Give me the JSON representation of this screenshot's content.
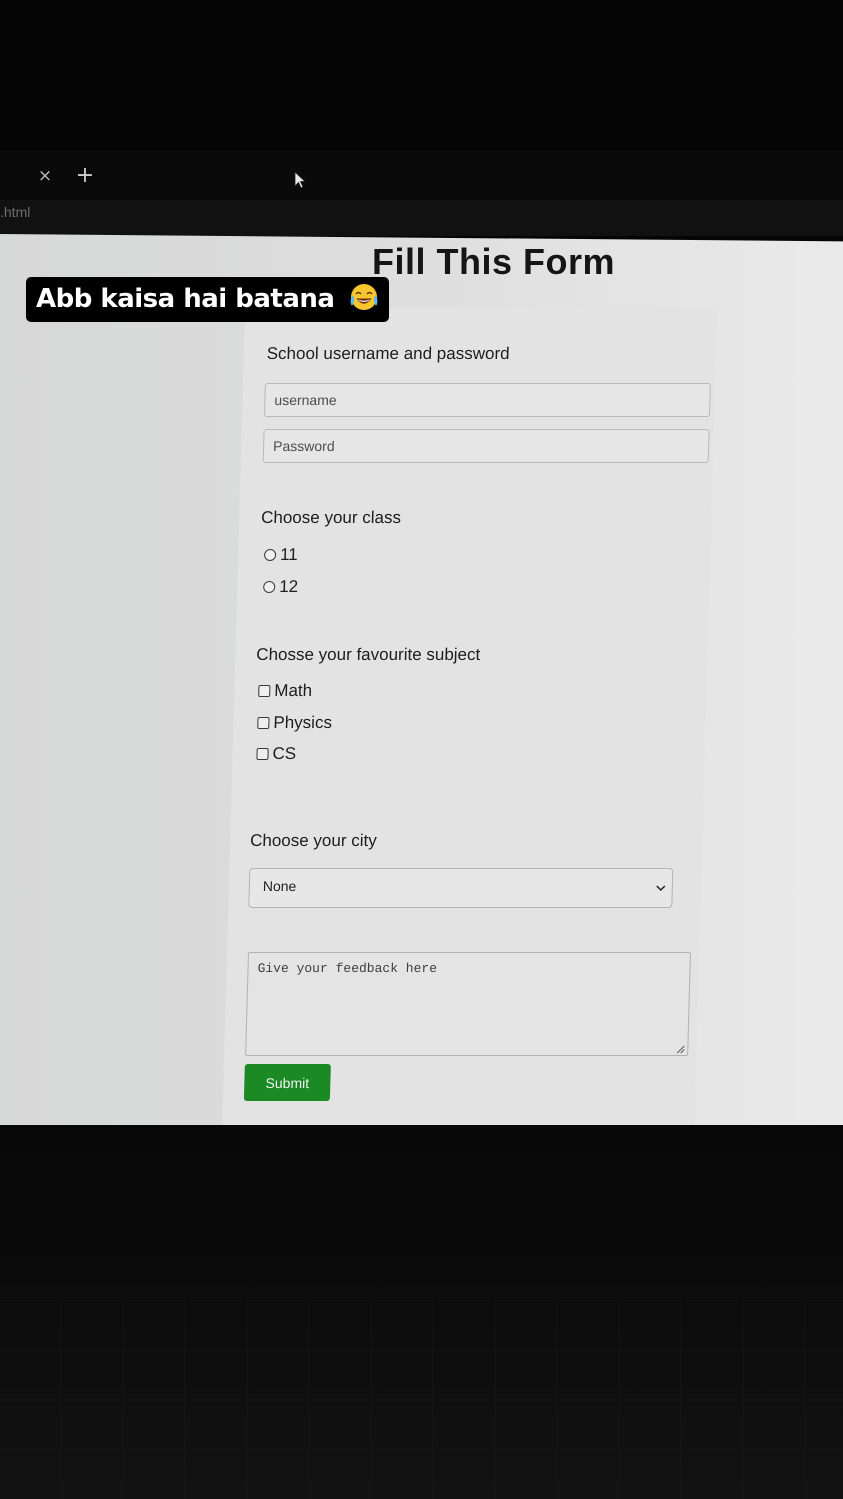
{
  "browser": {
    "tab_close_glyph": "×",
    "new_tab_glyph": "+",
    "address_fragment": ".html"
  },
  "overlay": {
    "caption": "Abb kaisa hai batana",
    "emoji_icon": "face-with-tears-of-joy-icon"
  },
  "page": {
    "title": "Fill This Form"
  },
  "form": {
    "credentials": {
      "label": "School username and password",
      "username_placeholder": "username",
      "password_placeholder": "Password"
    },
    "class_group": {
      "label": "Choose your class",
      "options": [
        "11",
        "12"
      ],
      "selected": null
    },
    "subject_group": {
      "label": "Chosse your favourite subject",
      "options": [
        "Math",
        "Physics",
        "CS"
      ],
      "checked": []
    },
    "city_group": {
      "label": "Choose your city",
      "selected_value": "None"
    },
    "feedback": {
      "placeholder": "Give your feedback here"
    },
    "submit_label": "Submit"
  },
  "colors": {
    "submit_bg": "#1b8a25",
    "page_bg": "#dcdcdc",
    "card_bg": "#e3e3e3"
  }
}
